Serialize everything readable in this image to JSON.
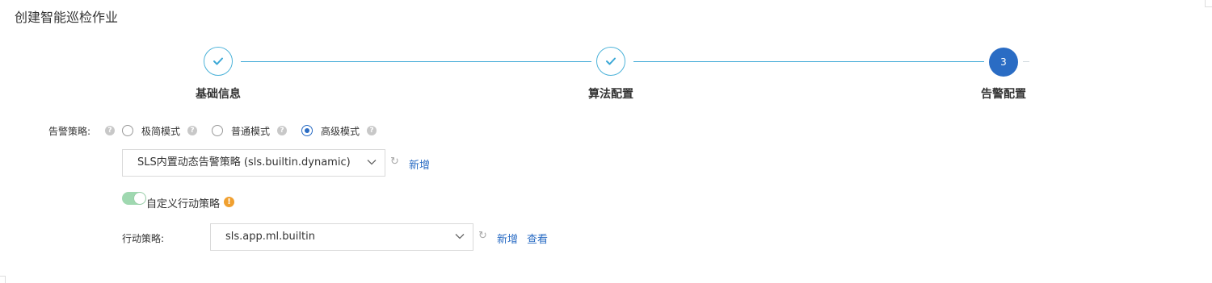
{
  "page": {
    "title": "创建智能巡检作业"
  },
  "steps": [
    {
      "label": "基础信息",
      "status": "done"
    },
    {
      "label": "算法配置",
      "status": "done"
    },
    {
      "label": "告警配置",
      "status": "active",
      "number": "3"
    }
  ],
  "alert_policy": {
    "label": "告警策略:",
    "modes": [
      {
        "label": "极简模式",
        "checked": false
      },
      {
        "label": "普通模式",
        "checked": false
      },
      {
        "label": "高级模式",
        "checked": true
      }
    ],
    "selected_policy": "SLS内置动态告警策略 (sls.builtin.dynamic)",
    "add_label": "新增"
  },
  "custom_action": {
    "toggle_label": "自定义行动策略",
    "enabled": true
  },
  "action_policy": {
    "label": "行动策略:",
    "selected": "sls.app.ml.builtin",
    "add_label": "新增",
    "view_label": "查看"
  },
  "colors": {
    "accent": "#2a6cc4",
    "step_line": "#3ba8d6",
    "toggle_on": "#9fd8b0",
    "warning": "#f0a030"
  }
}
